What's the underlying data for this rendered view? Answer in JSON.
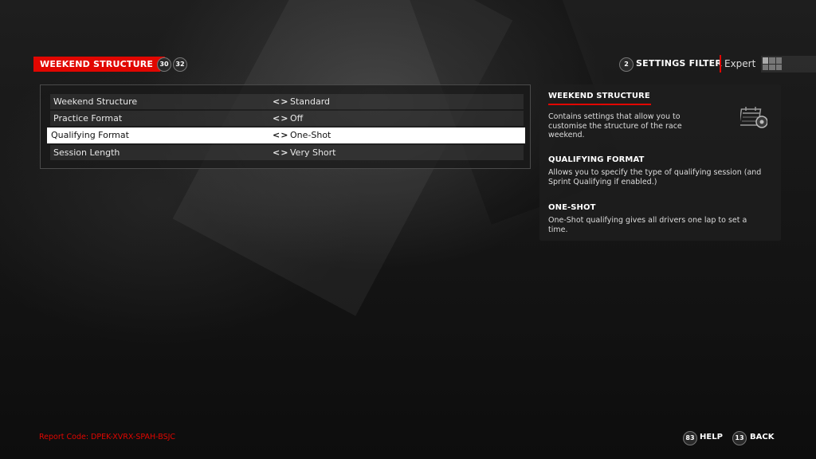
{
  "header": {
    "title": "WEEKEND STRUCTURE",
    "prev_button_glyph": "30",
    "next_button_glyph": "32",
    "filter_button_glyph": "2",
    "filter_label": "SETTINGS FILTER",
    "filter_value": "Expert",
    "view_icon": "grid-view-icon"
  },
  "settings": {
    "rows": [
      {
        "label": "Weekend Structure",
        "arrows": "<>",
        "value": "Standard",
        "selected": false
      },
      {
        "label": "Practice Format",
        "arrows": "<>",
        "value": "Off",
        "selected": false
      },
      {
        "label": "Qualifying Format",
        "arrows": "<>",
        "value": "One-Shot",
        "selected": true
      },
      {
        "label": "Session Length",
        "arrows": "<>",
        "value": "Very Short",
        "selected": false
      }
    ]
  },
  "info": {
    "section_title": "WEEKEND STRUCTURE",
    "section_text": "Contains settings that allow you to customise the structure of the race weekend.",
    "setting_title": "QUALIFYING FORMAT",
    "setting_text": "Allows you to specify the type of qualifying session (and Sprint Qualifying if enabled.)",
    "value_title": "ONE-SHOT",
    "value_text": "One-Shot qualifying gives all drivers one lap to set a time.",
    "icon": "calendar-settings-icon"
  },
  "footer": {
    "report_code": "Report Code: DPEK-XVRX-SPAH-BSJC",
    "help_glyph": "83",
    "help_label": "HELP",
    "back_glyph": "13",
    "back_label": "BACK"
  },
  "colors": {
    "accent": "#e10600",
    "selected_row_bg": "#ffffff",
    "background": "#161616"
  }
}
